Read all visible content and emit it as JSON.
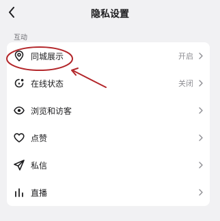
{
  "header": {
    "title": "隐私设置"
  },
  "section": {
    "label": "互动"
  },
  "items": [
    {
      "label": "同城展示",
      "value": "开启",
      "icon": "location-pin-icon"
    },
    {
      "label": "在线状态",
      "value": "关闭",
      "icon": "online-status-icon"
    },
    {
      "label": "浏览和访客",
      "value": "",
      "icon": "eye-icon"
    },
    {
      "label": "点赞",
      "value": "",
      "icon": "heart-icon"
    },
    {
      "label": "私信",
      "value": "",
      "icon": "send-icon"
    },
    {
      "label": "直播",
      "value": "",
      "icon": "live-bars-icon"
    }
  ],
  "annotation": {
    "color": "#b3262a"
  }
}
